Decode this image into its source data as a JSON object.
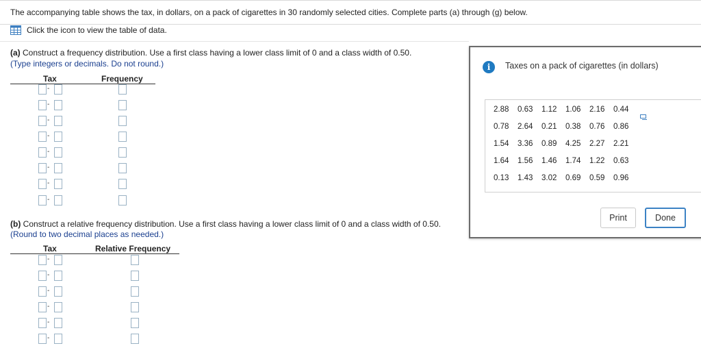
{
  "question": {
    "prompt": "The accompanying table shows the tax, in dollars, on a pack of cigarettes in 30 randomly selected cities. Complete parts (a) through (g) below.",
    "data_link_label": "Click the icon to view the table of data."
  },
  "part_a": {
    "label": "(a)",
    "instruction": "Construct a frequency distribution. Use a first class having a lower class limit of 0 and a class width of 0.50.",
    "hint": "(Type integers or decimals. Do not round.)",
    "col_tax": "Tax",
    "col_freq": "Frequency",
    "class_separator": "-"
  },
  "part_b": {
    "label": "(b)",
    "instruction": "Construct a relative frequency distribution. Use a first class having a lower class limit of 0 and a class width of 0.50.",
    "hint": "(Round to two decimal places as needed.)",
    "col_tax": "Tax",
    "col_freq": "Relative Frequency",
    "class_separator": "-"
  },
  "popup": {
    "title": "Taxes on a pack of cigarettes (in dollars)",
    "info_icon_glyph": "i",
    "rows": [
      [
        "2.88",
        "0.63",
        "1.12",
        "1.06",
        "2.16",
        "0.44"
      ],
      [
        "0.78",
        "2.64",
        "0.21",
        "0.38",
        "0.76",
        "0.86"
      ],
      [
        "1.54",
        "3.36",
        "0.89",
        "4.25",
        "2.27",
        "2.21"
      ],
      [
        "1.64",
        "1.56",
        "1.46",
        "1.74",
        "1.22",
        "0.63"
      ],
      [
        "0.13",
        "1.43",
        "3.02",
        "0.69",
        "0.59",
        "0.96"
      ]
    ],
    "print_label": "Print",
    "done_label": "Done"
  },
  "icons": {
    "data_table": "grid-table-icon",
    "info": "info-icon",
    "copy": "copy-icon"
  },
  "colors": {
    "hint_text": "#1a3f8f",
    "input_border": "#9ab2c4",
    "info_icon": "#1f7ac1",
    "done_border": "#3b82c4"
  }
}
